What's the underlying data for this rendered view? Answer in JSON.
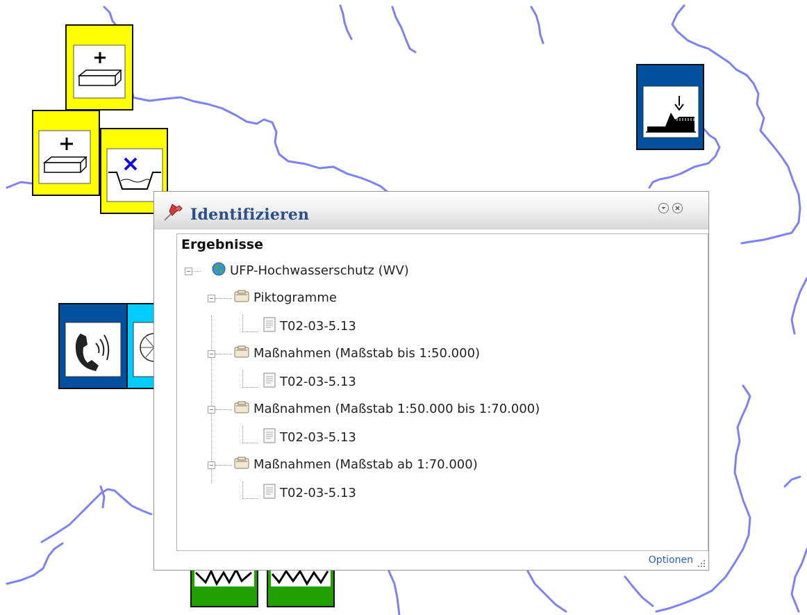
{
  "map": {
    "river_color": "#7b82f2"
  },
  "dialog": {
    "title": "Identifizieren",
    "title_color": "#2a4f8f",
    "results_heading": "Ergebnisse",
    "options_label": "Optionen",
    "tree": {
      "root": {
        "label": "UFP-Hochwasserschutz (WV)",
        "icon": "globe-icon",
        "groups": [
          {
            "label": "Piktogramme",
            "icon": "folder-icon",
            "items": [
              {
                "label": "T02-03-5.13",
                "icon": "document-icon"
              }
            ]
          },
          {
            "label": "Maßnahmen (Maßstab bis 1:50.000)",
            "icon": "folder-icon",
            "items": [
              {
                "label": "T02-03-5.13",
                "icon": "document-icon"
              }
            ]
          },
          {
            "label": "Maßnahmen (Maßstab 1:50.000 bis 1:70.000)",
            "icon": "folder-icon",
            "items": [
              {
                "label": "T02-03-5.13",
                "icon": "document-icon"
              }
            ]
          },
          {
            "label": "Maßnahmen (Maßstab ab 1:70.000)",
            "icon": "folder-icon",
            "items": [
              {
                "label": "T02-03-5.13",
                "icon": "document-icon"
              }
            ]
          }
        ]
      }
    }
  },
  "colors": {
    "pikto_yellow": "#ffff00",
    "pikto_blue": "#0050a0",
    "pikto_cyan": "#00ccff",
    "pikto_green": "#22a000",
    "link": "#2c5fa9"
  }
}
